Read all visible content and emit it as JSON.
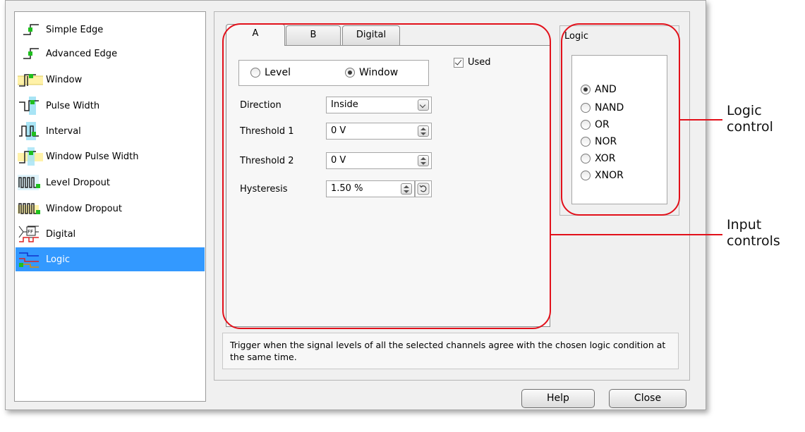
{
  "trigger_types": [
    {
      "label": "Simple Edge",
      "icon": "simple-edge-icon"
    },
    {
      "label": "Advanced Edge",
      "icon": "advanced-edge-icon"
    },
    {
      "label": "Window",
      "icon": "window-icon"
    },
    {
      "label": "Pulse Width",
      "icon": "pulse-width-icon"
    },
    {
      "label": "Interval",
      "icon": "interval-icon"
    },
    {
      "label": "Window Pulse Width",
      "icon": "window-pulse-width-icon"
    },
    {
      "label": "Level Dropout",
      "icon": "level-dropout-icon"
    },
    {
      "label": "Window Dropout",
      "icon": "window-dropout-icon"
    },
    {
      "label": "Digital",
      "icon": "digital-icon"
    },
    {
      "label": "Logic",
      "icon": "logic-icon",
      "selected": true
    }
  ],
  "tabs": [
    "A",
    "B",
    "Digital"
  ],
  "active_tab": "A",
  "mode": {
    "level_label": "Level",
    "window_label": "Window",
    "selected": "Window"
  },
  "used": {
    "label": "Used",
    "checked": true
  },
  "fields": {
    "direction": {
      "label": "Direction",
      "value": "Inside"
    },
    "threshold1": {
      "label": "Threshold 1",
      "value": "0 V"
    },
    "threshold2": {
      "label": "Threshold 2",
      "value": "0 V"
    },
    "hysteresis": {
      "label": "Hysteresis",
      "value": "1.50 %"
    }
  },
  "logic": {
    "title": "Logic",
    "options": [
      "AND",
      "NAND",
      "OR",
      "NOR",
      "XOR",
      "XNOR"
    ],
    "selected": "AND"
  },
  "description": "Trigger when the signal levels of all the selected channels agree with the chosen logic condition at the same time.",
  "buttons": {
    "help": "Help",
    "close": "Close"
  },
  "annotations": {
    "logic_control": [
      "Logic",
      "control"
    ],
    "input_controls": [
      "Input",
      "controls"
    ],
    "color": "#e2101a"
  },
  "colors": {
    "selection": "#3399ff",
    "icon_green": "#1fbf1f",
    "icon_yellow": "#fff2a8",
    "icon_cyan": "#a8e4f5"
  }
}
